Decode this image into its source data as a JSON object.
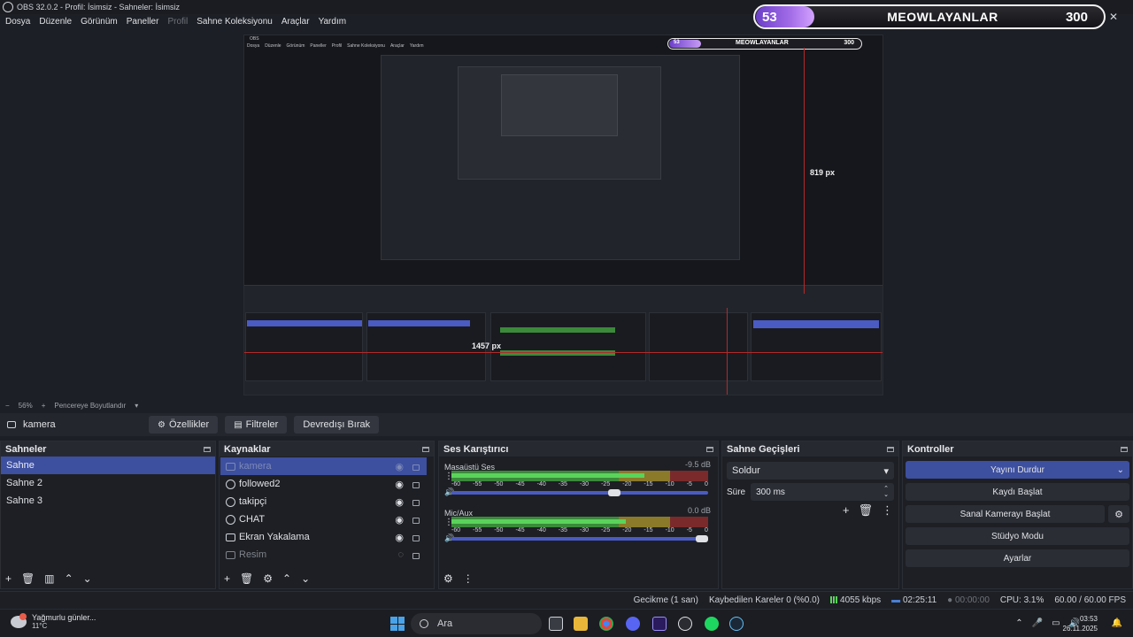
{
  "window": {
    "title": "OBS 32.0.2 - Profil: İsimsiz - Sahneler: İsimsiz"
  },
  "menu": [
    "Dosya",
    "Düzenle",
    "Görünüm",
    "Paneller",
    "Profil",
    "Sahne Koleksiyonu",
    "Araçlar",
    "Yardım"
  ],
  "overlay": {
    "level": "53",
    "name": "MEOWLAYANLAR",
    "count": "300",
    "close": "✕"
  },
  "preview": {
    "measure_h": "819 px",
    "measure_w": "1457 px",
    "inner_banner_name": "MEOWLAYANLAR",
    "inner_banner_count": "300",
    "inner_banner_level": "53"
  },
  "preview_status": {
    "zoom": "56%",
    "minus": "−",
    "plus": "+",
    "fit": "Pencereye Boyutlandır"
  },
  "source_toolbar": {
    "selected_source": "kamera",
    "properties": "Özellikler",
    "filters": "Filtreler",
    "deactivate": "Devredışı Bırak"
  },
  "scenes": {
    "title": "Sahneler",
    "items": [
      "Sahne",
      "Sahne 2",
      "Sahne 3"
    ],
    "selected": 0
  },
  "sources": {
    "title": "Kaynaklar",
    "items": [
      {
        "name": "kamera",
        "icon": "camera-icon",
        "visible": true
      },
      {
        "name": "followed2",
        "icon": "globe-icon",
        "visible": true
      },
      {
        "name": "takipçi",
        "icon": "globe-icon",
        "visible": true
      },
      {
        "name": "CHAT",
        "icon": "globe-icon",
        "visible": true
      },
      {
        "name": "Ekran Yakalama",
        "icon": "monitor-icon",
        "visible": true
      },
      {
        "name": "Resim",
        "icon": "image-icon",
        "visible": false
      }
    ]
  },
  "mixer": {
    "title": "Ses Karıştırıcı",
    "channels": [
      {
        "name": "Masaüstü Ses",
        "db": "-9.5 dB",
        "level": 0.75,
        "volume": 0.66
      },
      {
        "name": "Mic/Aux",
        "db": "0.0 dB",
        "level": 0.68,
        "volume": 1.0
      }
    ],
    "ticks": [
      "-60",
      "-55",
      "-50",
      "-45",
      "-40",
      "-35",
      "-30",
      "-25",
      "-20",
      "-15",
      "-10",
      "-5",
      "0"
    ]
  },
  "transitions": {
    "title": "Sahne Geçişleri",
    "selected": "Soldur",
    "duration_label": "Süre",
    "duration_value": "300 ms"
  },
  "controls": {
    "title": "Kontroller",
    "stop_stream": "Yayını Durdur",
    "start_record": "Kaydı Başlat",
    "virtual_cam": "Sanal Kamerayı Başlat",
    "studio_mode": "Stüdyo Modu",
    "settings": "Ayarlar"
  },
  "status": {
    "delay": "Gecikme (1 san)",
    "dropped": "Kaybedilen Kareler 0 (%0.0)",
    "bitrate": "4055 kbps",
    "stream_time": "02:25:11",
    "record_time": "00:00:00",
    "cpu": "CPU: 3.1%",
    "fps": "60.00 / 60.00 FPS"
  },
  "taskbar": {
    "weather_title": "Yağmurlu günler...",
    "weather_temp": "11°C",
    "search": "Ara",
    "time": "03:53",
    "date": "26.11.2025"
  },
  "colors": {
    "accent": "#3d4f9f",
    "meter_green": "#5bd35b",
    "measure_red": "#b12a2a"
  }
}
